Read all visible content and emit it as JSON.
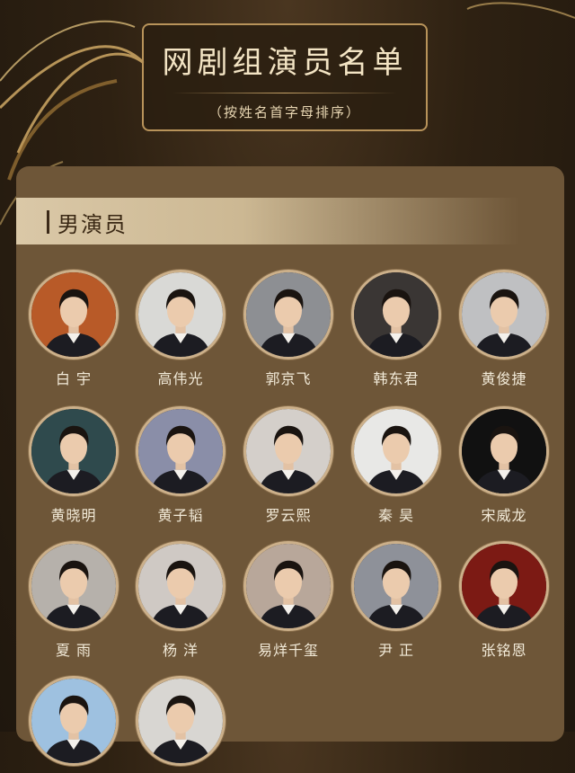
{
  "header": {
    "title": "网剧组演员名单",
    "subtitle": "（按姓名首字母排序）"
  },
  "section": {
    "label": "男演员"
  },
  "colors": {
    "background": "#2e2112",
    "panel": "#6e5638",
    "gold": "#c8a468",
    "section_bar": "#dac8a7",
    "name_text": "#f2ead8"
  },
  "actors": [
    {
      "name": "白  宇",
      "photo_bg": "#b85a28"
    },
    {
      "name": "高伟光",
      "photo_bg": "#d9d9d6"
    },
    {
      "name": "郭京飞",
      "photo_bg": "#8d8f93"
    },
    {
      "name": "韩东君",
      "photo_bg": "#3a3634"
    },
    {
      "name": "黄俊捷",
      "photo_bg": "#bfc0c2"
    },
    {
      "name": "黄晓明",
      "photo_bg": "#2f4a4d"
    },
    {
      "name": "黄子韬",
      "photo_bg": "#8a8ea8"
    },
    {
      "name": "罗云熙",
      "photo_bg": "#d4cfca"
    },
    {
      "name": "秦  昊",
      "photo_bg": "#e8e8e6"
    },
    {
      "name": "宋威龙",
      "photo_bg": "#111111"
    },
    {
      "name": "夏  雨",
      "photo_bg": "#b6b1ab"
    },
    {
      "name": "杨  洋",
      "photo_bg": "#cfc9c4"
    },
    {
      "name": "易烊千玺",
      "photo_bg": "#b8a79a"
    },
    {
      "name": "尹  正",
      "photo_bg": "#8e9199"
    },
    {
      "name": "张铭恩",
      "photo_bg": "#7c1a14"
    },
    {
      "name": "",
      "photo_bg": "#9ec1e0"
    },
    {
      "name": "",
      "photo_bg": "#d8d6d2"
    }
  ]
}
